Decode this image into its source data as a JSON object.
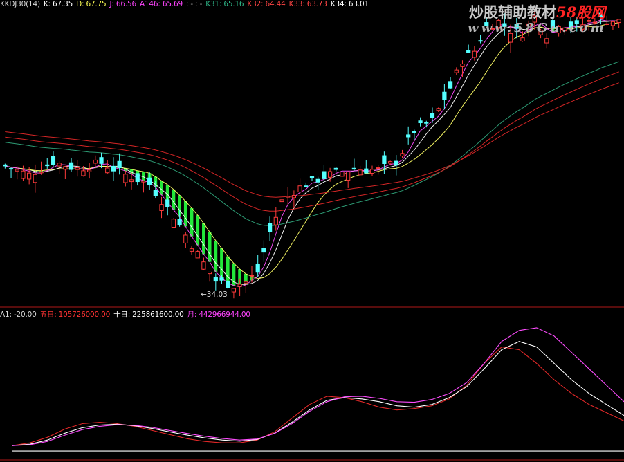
{
  "header_top": [
    {
      "text": "KKDJ30(14)",
      "color": "#d8d8d8"
    },
    {
      "text": "K: 67.35",
      "color": "#ffffff"
    },
    {
      "text": "D: 67.75",
      "color": "#ffff55"
    },
    {
      "text": "J: 66.56",
      "color": "#ff44ff"
    },
    {
      "text": "A146: 65.69",
      "color": "#ff44ff"
    },
    {
      "text": ": - : -",
      "color": "#9a9a9a"
    },
    {
      "text": "K31: 65.16",
      "color": "#2fb98a"
    },
    {
      "text": "K32: 64.44",
      "color": "#ff4444"
    },
    {
      "text": "K33: 63.73",
      "color": "#ff4444"
    },
    {
      "text": "K34: 63.01",
      "color": "#ffffff"
    }
  ],
  "header_bottom": [
    {
      "text": "A1: -20.00",
      "color": "#d8d8d8"
    },
    {
      "text": "五日: 105726000.00",
      "color": "#ff3333"
    },
    {
      "text": "十日: 225861600.00",
      "color": "#ffffff"
    },
    {
      "text": "月: 442966944.00",
      "color": "#ff44ff"
    }
  ],
  "watermark": {
    "text_main": "炒股辅助教材",
    "text_accent": "58股网",
    "url": "www.58Gu.com"
  },
  "annotation": {
    "low_label": "←34.03"
  },
  "colors": {
    "background": "#000000",
    "up_candle": "#ff3b3b",
    "down_candle": "#54ffff",
    "ribbon_fill": "#22e83a",
    "divider": "#b01818",
    "ma_fast": "#ffffff",
    "ma_mid": "#ffff66",
    "ma_purple": "#ff4dff",
    "ma_green": "#2fa37a",
    "ma_red": "#e02828"
  },
  "chart_data": [
    {
      "type": "candlestick",
      "title": "",
      "ylim": [
        32,
        82
      ],
      "price_low_marked": 34.03,
      "bars": 103,
      "candle_anchors": [
        {
          "i": 0,
          "close": 55.5
        },
        {
          "i": 4,
          "close": 54.0
        },
        {
          "i": 8,
          "close": 56.2
        },
        {
          "i": 12,
          "close": 55.0
        },
        {
          "i": 16,
          "close": 56.0
        },
        {
          "i": 20,
          "close": 54.0
        },
        {
          "i": 24,
          "close": 52.4
        },
        {
          "i": 28,
          "close": 47.0
        },
        {
          "i": 32,
          "close": 40.5
        },
        {
          "i": 35,
          "close": 36.0
        },
        {
          "i": 38,
          "close": 35.2
        },
        {
          "i": 40,
          "close": 35.8
        },
        {
          "i": 42,
          "close": 37.5
        },
        {
          "i": 44,
          "close": 44.2
        },
        {
          "i": 46,
          "close": 49.5
        },
        {
          "i": 48,
          "close": 51.2
        },
        {
          "i": 50,
          "close": 52.5
        },
        {
          "i": 54,
          "close": 54.0
        },
        {
          "i": 58,
          "close": 55.0
        },
        {
          "i": 62,
          "close": 54.8
        },
        {
          "i": 65,
          "close": 56.2
        },
        {
          "i": 68,
          "close": 61.5
        },
        {
          "i": 71,
          "close": 63.2
        },
        {
          "i": 74,
          "close": 68.8
        },
        {
          "i": 76,
          "close": 73.5
        },
        {
          "i": 78,
          "close": 75.0
        },
        {
          "i": 80,
          "close": 79.2
        },
        {
          "i": 82,
          "close": 80.0
        },
        {
          "i": 84,
          "close": 78.5
        },
        {
          "i": 86,
          "close": 78.0
        },
        {
          "i": 88,
          "close": 80.8
        },
        {
          "i": 90,
          "close": 77.8
        },
        {
          "i": 92,
          "close": 79.8
        },
        {
          "i": 95,
          "close": 79.0
        },
        {
          "i": 98,
          "close": 80.5
        },
        {
          "i": 102,
          "close": 80.0
        }
      ],
      "moving_averages": [
        {
          "name": "",
          "color": "#ffffff",
          "period": 5
        },
        {
          "name": "",
          "color": "#ffff66",
          "period": 10
        },
        {
          "name": "",
          "color": "#ff4dff",
          "period": 3
        },
        {
          "name": "",
          "color": "#2fa37a",
          "period": 20
        },
        {
          "name": "",
          "color": "#e02828",
          "period": 26
        },
        {
          "name": "",
          "color": "#e02828",
          "period": 34
        }
      ]
    },
    {
      "type": "line",
      "title": "",
      "ylim": [
        -40,
        460
      ],
      "series": [
        {
          "name": "五日",
          "color": "#e02828",
          "values": [
            0,
            10,
            30,
            60,
            80,
            85,
            80,
            70,
            55,
            40,
            25,
            15,
            10,
            10,
            20,
            50,
            100,
            150,
            180,
            175,
            160,
            140,
            130,
            135,
            145,
            170,
            220,
            300,
            360,
            350,
            300,
            240,
            190,
            150,
            120,
            90
          ]
        },
        {
          "name": "十日",
          "color": "#ffffff",
          "values": [
            0,
            5,
            20,
            45,
            65,
            75,
            78,
            72,
            62,
            50,
            38,
            28,
            20,
            16,
            22,
            45,
            85,
            130,
            165,
            175,
            170,
            160,
            145,
            140,
            150,
            175,
            215,
            280,
            350,
            380,
            360,
            300,
            240,
            190,
            150,
            110
          ]
        },
        {
          "name": "月",
          "color": "#ff4dff",
          "values": [
            0,
            3,
            15,
            38,
            58,
            70,
            76,
            74,
            66,
            55,
            44,
            34,
            26,
            20,
            24,
            44,
            80,
            125,
            160,
            178,
            180,
            172,
            160,
            158,
            168,
            190,
            230,
            300,
            380,
            420,
            430,
            400,
            340,
            280,
            220,
            160
          ]
        },
        {
          "name": "A1",
          "color": "#ffffff",
          "values": [
            -20,
            -20,
            -20,
            -20,
            -20,
            -20,
            -20,
            -20,
            -20,
            -20,
            -20,
            -20,
            -20,
            -20,
            -20,
            -20,
            -20,
            -20,
            -20,
            -20,
            -20,
            -20,
            -20,
            -20,
            -20,
            -20,
            -20,
            -20,
            -20,
            -20,
            -20,
            -20,
            -20,
            -20,
            -20,
            -20
          ]
        }
      ]
    }
  ]
}
